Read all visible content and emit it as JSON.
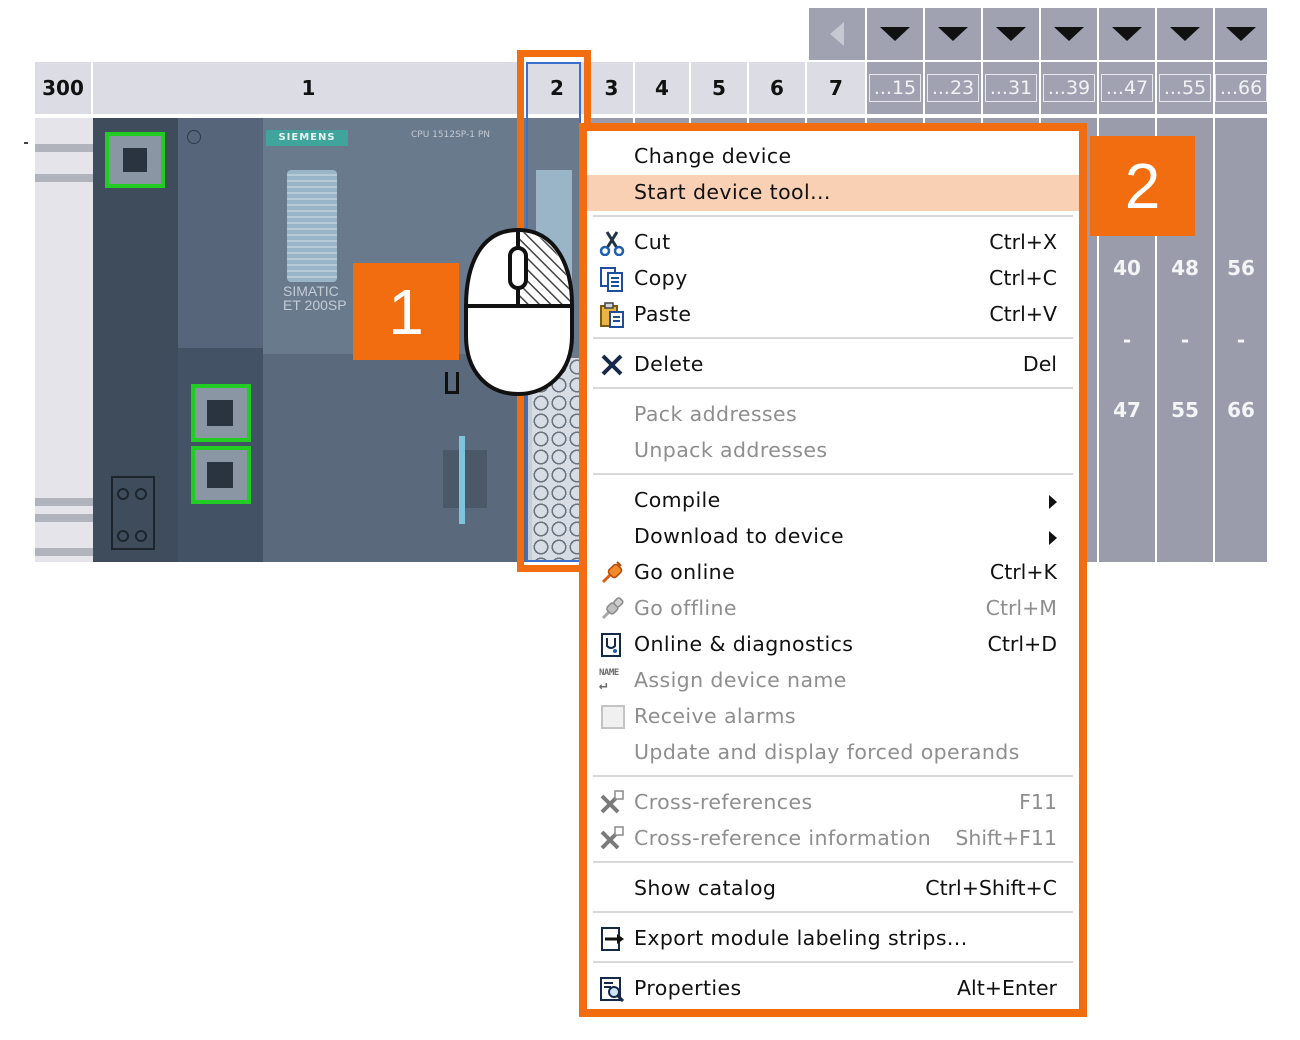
{
  "rack": {
    "header_slots": [
      "300",
      "1",
      "2",
      "3",
      "4",
      "5",
      "6",
      "7",
      "...15",
      "...23",
      "...31",
      "...39",
      "...47",
      "...55",
      "...66"
    ],
    "module_text": {
      "brand": "SIEMENS",
      "cpu_label": "CPU 1512SP-1 PN",
      "product_line1": "SIMATIC",
      "product_line2": "ET 200SP"
    },
    "address_cols": [
      {
        "start": "40",
        "dash": "-",
        "end": "47"
      },
      {
        "start": "48",
        "dash": "-",
        "end": "55"
      },
      {
        "start": "56",
        "dash": "-",
        "end": "66"
      }
    ]
  },
  "callouts": {
    "step1": "1",
    "step2": "2"
  },
  "context_menu": {
    "items": [
      {
        "label": "Change device",
        "shortcut": "",
        "icon": "",
        "disabled": false
      },
      {
        "label": "Start device tool...",
        "shortcut": "",
        "icon": "",
        "disabled": false,
        "highlighted": true
      },
      {
        "label": "Cut",
        "shortcut": "Ctrl+X",
        "icon": "scissors-icon",
        "disabled": false
      },
      {
        "label": "Copy",
        "shortcut": "Ctrl+C",
        "icon": "copy-icon",
        "disabled": false
      },
      {
        "label": "Paste",
        "shortcut": "Ctrl+V",
        "icon": "paste-icon",
        "disabled": false
      },
      {
        "label": "Delete",
        "shortcut": "Del",
        "icon": "delete-x-icon",
        "disabled": false
      },
      {
        "label": "Pack addresses",
        "shortcut": "",
        "icon": "",
        "disabled": true
      },
      {
        "label": "Unpack addresses",
        "shortcut": "",
        "icon": "",
        "disabled": true
      },
      {
        "label": "Compile",
        "shortcut": "",
        "icon": "",
        "disabled": false,
        "submenu": true
      },
      {
        "label": "Download to device",
        "shortcut": "",
        "icon": "",
        "disabled": false,
        "submenu": true
      },
      {
        "label": "Go online",
        "shortcut": "Ctrl+K",
        "icon": "go-online-icon",
        "disabled": false
      },
      {
        "label": "Go offline",
        "shortcut": "Ctrl+M",
        "icon": "go-offline-icon",
        "disabled": true
      },
      {
        "label": "Online & diagnostics",
        "shortcut": "Ctrl+D",
        "icon": "diagnostics-icon",
        "disabled": false
      },
      {
        "label": "Assign device name",
        "shortcut": "",
        "icon": "name-icon",
        "name_glyph": "NAME",
        "disabled": true
      },
      {
        "label": "Receive alarms",
        "shortcut": "",
        "icon": "checkbox-icon",
        "disabled": true
      },
      {
        "label": "Update and display forced operands",
        "shortcut": "",
        "icon": "",
        "disabled": true
      },
      {
        "label": "Cross-references",
        "shortcut": "F11",
        "icon": "cross-reference-icon",
        "disabled": true
      },
      {
        "label": "Cross-reference information",
        "shortcut": "Shift+F11",
        "icon": "cross-reference-info-icon",
        "disabled": true
      },
      {
        "label": "Show catalog",
        "shortcut": "Ctrl+Shift+C",
        "icon": "",
        "disabled": false
      },
      {
        "label": "Export module labeling strips...",
        "shortcut": "",
        "icon": "export-icon",
        "disabled": false
      },
      {
        "label": "Properties",
        "shortcut": "Alt+Enter",
        "icon": "properties-icon",
        "disabled": false
      }
    ]
  },
  "colors": {
    "accent_orange": "#f26d0f",
    "highlight": "#f9d0b4",
    "port_green": "#22cc22",
    "rack_gray": "#9a9cac"
  }
}
